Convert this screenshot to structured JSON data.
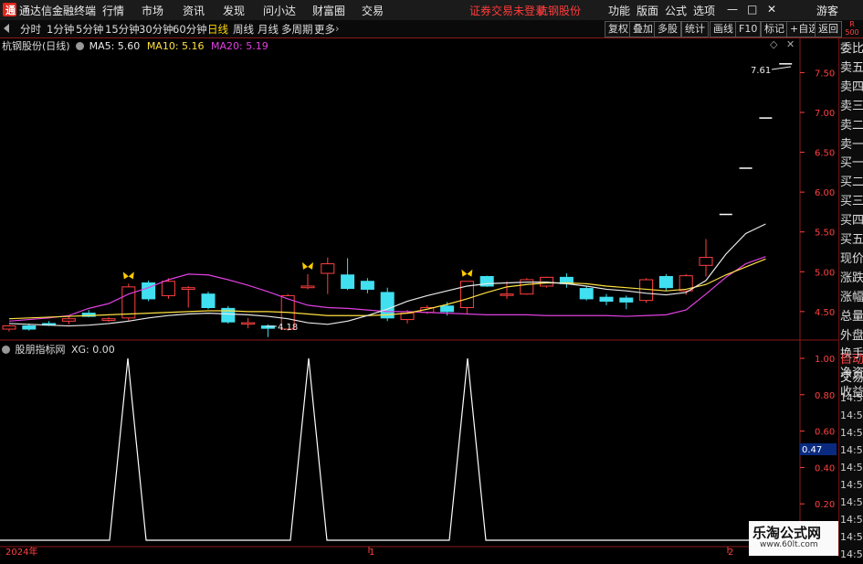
{
  "app": {
    "title": "通达信金融终端"
  },
  "menu": [
    "行情",
    "市场",
    "资讯",
    "发现",
    "问小达",
    "财富圈",
    "交易"
  ],
  "account_status": "证券交易未登录",
  "stock_name_top": "杭钢股份",
  "right_menu": [
    "功能",
    "版面",
    "公式",
    "选项"
  ],
  "window_controls": {
    "min": "—",
    "max": "□",
    "close": "✕"
  },
  "guest_label": "游客",
  "periods": [
    "分时",
    "1分钟",
    "5分钟",
    "15分钟",
    "30分钟",
    "60分钟",
    "日线",
    "周线",
    "月线",
    "多周期",
    "更多"
  ],
  "active_period": "日线",
  "toolbar_buttons": [
    "复权",
    "叠加",
    "多股",
    "统计",
    "画线",
    "F10",
    "标记",
    "+自选",
    "返回"
  ],
  "corner_badge": {
    "top": "R",
    "bottom": "500"
  },
  "main_chart": {
    "title": "杭钢股份(日线)",
    "ma5_label": "MA5: 5.60",
    "ma10_label": "MA10: 5.16",
    "ma20_label": "MA20: 5.19",
    "y_ticks": [
      "7.50",
      "7.00",
      "6.50",
      "6.00",
      "5.50",
      "5.00",
      "4.50"
    ],
    "high_annotation": "7.61",
    "low_annotation": "4.18",
    "colors": {
      "up": "#ff4040",
      "down": "#40e0f0",
      "ma5": "#e8e8e8",
      "ma10": "#ffe040",
      "ma20": "#e040e0"
    }
  },
  "chart_data": {
    "type": "candlestick",
    "title": "杭钢股份(日线)",
    "ylim": [
      4.2,
      7.7
    ],
    "candles": [
      {
        "o": 4.28,
        "h": 4.33,
        "l": 4.25,
        "c": 4.32
      },
      {
        "o": 4.32,
        "h": 4.35,
        "l": 4.26,
        "c": 4.28
      },
      {
        "o": 4.35,
        "h": 4.38,
        "l": 4.32,
        "c": 4.33
      },
      {
        "o": 4.38,
        "h": 4.44,
        "l": 4.34,
        "c": 4.41
      },
      {
        "o": 4.48,
        "h": 4.52,
        "l": 4.43,
        "c": 4.44
      },
      {
        "o": 4.39,
        "h": 4.43,
        "l": 4.37,
        "c": 4.41
      },
      {
        "o": 4.42,
        "h": 4.85,
        "l": 4.38,
        "c": 4.81
      },
      {
        "o": 4.86,
        "h": 4.89,
        "l": 4.63,
        "c": 4.66
      },
      {
        "o": 4.7,
        "h": 4.92,
        "l": 4.66,
        "c": 4.88
      },
      {
        "o": 4.78,
        "h": 4.82,
        "l": 4.55,
        "c": 4.8
      },
      {
        "o": 4.72,
        "h": 4.75,
        "l": 4.53,
        "c": 4.55
      },
      {
        "o": 4.54,
        "h": 4.57,
        "l": 4.35,
        "c": 4.37
      },
      {
        "o": 4.35,
        "h": 4.42,
        "l": 4.29,
        "c": 4.36
      },
      {
        "o": 4.32,
        "h": 4.34,
        "l": 4.18,
        "c": 4.29
      },
      {
        "o": 4.28,
        "h": 4.72,
        "l": 4.26,
        "c": 4.7
      },
      {
        "o": 4.8,
        "h": 4.97,
        "l": 4.78,
        "c": 4.82
      },
      {
        "o": 4.98,
        "h": 5.18,
        "l": 4.72,
        "c": 5.1
      },
      {
        "o": 4.96,
        "h": 5.17,
        "l": 4.77,
        "c": 4.79
      },
      {
        "o": 4.88,
        "h": 4.92,
        "l": 4.73,
        "c": 4.78
      },
      {
        "o": 4.74,
        "h": 4.8,
        "l": 4.38,
        "c": 4.42
      },
      {
        "o": 4.4,
        "h": 4.52,
        "l": 4.35,
        "c": 4.48
      },
      {
        "o": 4.49,
        "h": 4.58,
        "l": 4.47,
        "c": 4.55
      },
      {
        "o": 4.57,
        "h": 4.62,
        "l": 4.45,
        "c": 4.5
      },
      {
        "o": 4.55,
        "h": 4.88,
        "l": 4.47,
        "c": 4.88
      },
      {
        "o": 4.94,
        "h": 4.95,
        "l": 4.81,
        "c": 4.82
      },
      {
        "o": 4.71,
        "h": 4.88,
        "l": 4.66,
        "c": 4.72
      },
      {
        "o": 4.72,
        "h": 4.92,
        "l": 4.71,
        "c": 4.9
      },
      {
        "o": 4.82,
        "h": 4.94,
        "l": 4.8,
        "c": 4.93
      },
      {
        "o": 4.93,
        "h": 4.98,
        "l": 4.8,
        "c": 4.85
      },
      {
        "o": 4.79,
        "h": 4.82,
        "l": 4.64,
        "c": 4.66
      },
      {
        "o": 4.68,
        "h": 4.72,
        "l": 4.58,
        "c": 4.63
      },
      {
        "o": 4.67,
        "h": 4.7,
        "l": 4.53,
        "c": 4.62
      },
      {
        "o": 4.64,
        "h": 4.92,
        "l": 4.61,
        "c": 4.9
      },
      {
        "o": 4.94,
        "h": 4.97,
        "l": 4.76,
        "c": 4.8
      },
      {
        "o": 4.76,
        "h": 4.97,
        "l": 4.71,
        "c": 4.95
      },
      {
        "o": 5.08,
        "h": 5.41,
        "l": 4.94,
        "c": 5.18
      },
      {
        "o": 5.72,
        "h": 5.72,
        "l": 5.72,
        "c": 5.72
      },
      {
        "o": 6.3,
        "h": 6.3,
        "l": 6.3,
        "c": 6.3
      },
      {
        "o": 6.93,
        "h": 6.93,
        "l": 6.93,
        "c": 6.93
      },
      {
        "o": 7.61,
        "h": 7.61,
        "l": 7.61,
        "c": 7.61
      }
    ],
    "ma5": [
      4.35,
      4.34,
      4.33,
      4.32,
      4.33,
      4.35,
      4.38,
      4.42,
      4.45,
      4.47,
      4.48,
      4.47,
      4.46,
      4.44,
      4.41,
      4.36,
      4.34,
      4.38,
      4.45,
      4.53,
      4.63,
      4.7,
      4.76,
      4.82,
      4.85,
      4.86,
      4.87,
      4.87,
      4.85,
      4.82,
      4.78,
      4.76,
      4.73,
      4.71,
      4.74,
      4.89,
      5.22,
      5.48,
      5.6
    ],
    "ma10": [
      4.41,
      4.42,
      4.43,
      4.44,
      4.45,
      4.46,
      4.47,
      4.48,
      4.49,
      4.5,
      4.51,
      4.51,
      4.5,
      4.5,
      4.49,
      4.47,
      4.45,
      4.45,
      4.45,
      4.46,
      4.48,
      4.53,
      4.59,
      4.66,
      4.74,
      4.81,
      4.84,
      4.86,
      4.86,
      4.85,
      4.82,
      4.8,
      4.78,
      4.76,
      4.78,
      4.84,
      4.96,
      5.06,
      5.16
    ],
    "ma20": [
      4.38,
      4.4,
      4.42,
      4.45,
      4.54,
      4.6,
      4.72,
      4.8,
      4.9,
      4.97,
      4.96,
      4.9,
      4.83,
      4.75,
      4.66,
      4.58,
      4.55,
      4.54,
      4.52,
      4.5,
      4.5,
      4.49,
      4.48,
      4.47,
      4.46,
      4.46,
      4.46,
      4.45,
      4.45,
      4.45,
      4.45,
      4.44,
      4.45,
      4.46,
      4.52,
      4.72,
      4.93,
      5.1,
      5.19
    ],
    "signal_markers": [
      6,
      15,
      23
    ]
  },
  "sub_chart": {
    "title": "股朋指标网",
    "xg_label": "XG: 0.00",
    "y_ticks": [
      "1.00",
      "0.80",
      "0.60",
      "0.40",
      "0.20"
    ],
    "value_box": "0.47",
    "signal_x": [
      140,
      338,
      512
    ]
  },
  "time_axis": {
    "year_label": "2024年",
    "mark1": "1",
    "mark2": "2"
  },
  "side_panel": [
    "委比",
    "卖五",
    "卖四",
    "卖三",
    "卖二",
    "卖一",
    "买一",
    "买二",
    "买三",
    "买四",
    "买五",
    "现价",
    "涨跌",
    "涨幅",
    "总量",
    "外盘",
    "换手",
    "净资",
    "收益"
  ],
  "side_panel2": [
    "自动",
    "交易"
  ],
  "side_times": [
    "14:56",
    "14:56",
    "14:56",
    "14:56",
    "14:56",
    "14:56",
    "14:56",
    "14:56",
    "14:56",
    "14:56"
  ],
  "watermark": {
    "line1": "乐淘公式网",
    "line2": "www.60lt.com"
  }
}
